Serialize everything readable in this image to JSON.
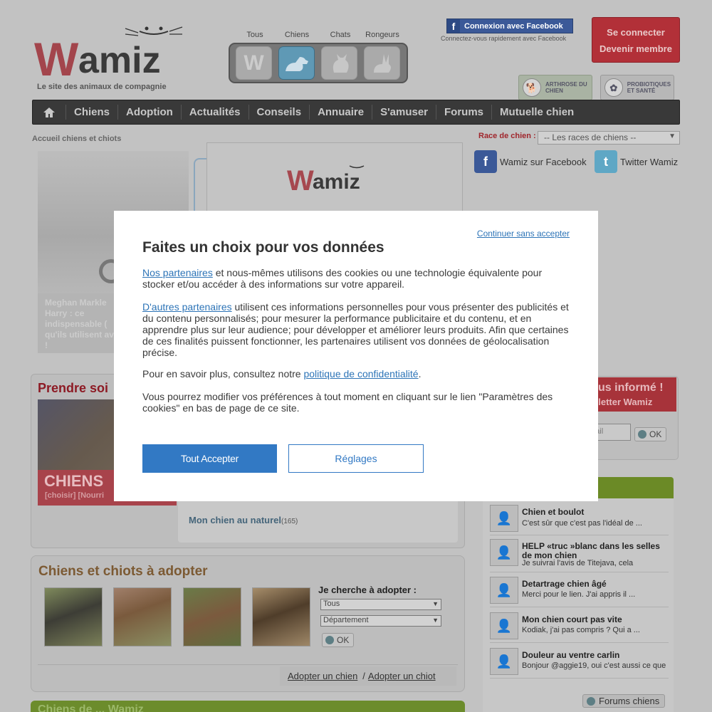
{
  "header": {
    "logo_text": "Wamiz",
    "tagline": "Le site des animaux de compagnie",
    "switcher": {
      "labels": [
        "Tous",
        "Chiens",
        "Chats",
        "Rongeurs"
      ],
      "tous_letter": "W"
    },
    "facebook_connect": "Connexion avec Facebook",
    "facebook_sub": "Connectez-vous rapidement avec Facebook",
    "login": "Se connecter",
    "register": "Devenir membre",
    "badges": [
      "ARTHROSE DU CHIEN",
      "PROBIOTIQUES ET SANTÉ"
    ]
  },
  "nav": {
    "items": [
      "Chiens",
      "Adoption",
      "Actualités",
      "Conseils",
      "Annuaire",
      "S'amuser",
      "Forums",
      "Mutuelle chien"
    ]
  },
  "breadcrumb": "Accueil chiens et chiots",
  "race": {
    "label": "Race de chien :",
    "selected": "-- Les races de chiens --"
  },
  "social": {
    "facebook": "Wamiz sur Facebook",
    "twitter": "Twitter Wamiz"
  },
  "slider": {
    "caption_l1": "Meghan  Markle",
    "caption_l2": "Harry  :  ce",
    "caption_l3": "indispensable  (",
    "caption_l4": "qu'ils utilisent av",
    "caption_l5": "!"
  },
  "popup_logo": "Wamiz",
  "care": {
    "title": "Prendre soi",
    "chiens": "CHIENS",
    "links": "[choisir] [Nourri"
  },
  "mon_chien": {
    "label": "Mon chien au naturel",
    "count": "(165)"
  },
  "adoption": {
    "title": "Chiens et chiots à adopter",
    "search_label": "Je cherche à adopter :",
    "type_select": "Tous",
    "dept_select": "Département",
    "ok": "OK",
    "link_dog": "Adopter un chien",
    "separator": "/",
    "link_puppy": "Adopter un chiot"
  },
  "bottom_title": "Chiens de ... Wamiz",
  "newsletter": {
    "line1": "us informé !",
    "line2": "sletter Wamiz",
    "email_placeholder": "mail",
    "ok": "OK"
  },
  "forum": {
    "items": [
      {
        "title": "Chien et boulot",
        "excerpt": "C'est sûr que c'est pas l'idéal de ..."
      },
      {
        "title": "HELP «truc »blanc dans les selles de mon chien",
        "excerpt": "Je suivrai l'avis de Titejava, cela"
      },
      {
        "title": "Detartrage chien âgé",
        "excerpt": "Merci pour le lien. J'ai appris il ..."
      },
      {
        "title": "Mon chien court pas vite",
        "excerpt": "Kodiak, j'ai pas compris ? Qui a ..."
      },
      {
        "title": "Douleur au ventre carlin",
        "excerpt": "Bonjour @aggie19, oui c'est aussi ce que"
      }
    ],
    "button": "Forums chiens"
  },
  "consent": {
    "continue": "Continuer sans accepter",
    "title": "Faites un choix pour vos données",
    "p1_link": "Nos partenaires",
    "p1_text": " et nous-mêmes utilisons des cookies ou une technologie équivalente pour stocker et/ou accéder à des informations sur votre appareil.",
    "p2_link": "D'autres partenaires",
    "p2_text": " utilisent ces informations personnelles pour vous présenter des publicités et du contenu personnalisés; pour mesurer la performance publicitaire et du contenu, et en apprendre plus sur leur audience; pour développer et améliorer leurs produits. Afin que certaines de ces finalités puissent fonctionner, les partenaires utilisent vos données de géolocalisation précise.",
    "p3_text": "Pour en savoir plus, consultez notre ",
    "p3_link": "politique de confidentialité",
    "p3_end": ".",
    "p4_text": "Vous pourrez modifier vos préférences à tout moment en cliquant sur le lien \"Paramètres des cookies\" en bas de page de ce site.",
    "accept": "Tout Accepter",
    "settings": "Réglages"
  },
  "colors": {
    "brand_red": "#b23038",
    "accent_blue": "#3279c4",
    "nav_dark": "#393939"
  }
}
